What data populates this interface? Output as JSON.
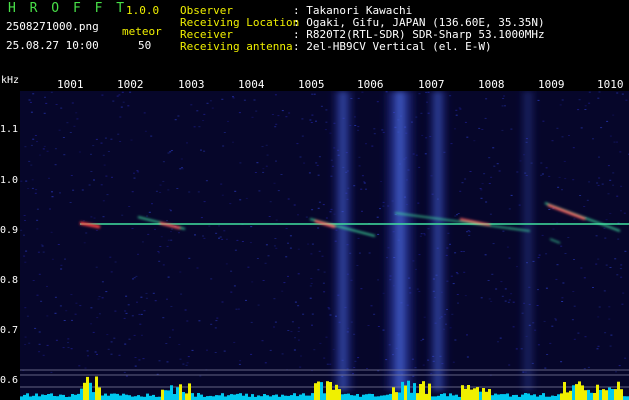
{
  "app": {
    "name": "H R O F F T",
    "version": "1.0.0",
    "filename": "2508271000.png",
    "mode": "meteor",
    "datetime": "25.08.27 10:00",
    "count": "50"
  },
  "info": {
    "observer_label": "Observer",
    "observer_value": ": Takanori Kawachi",
    "location_label": "Receiving Location",
    "location_value": ": Ogaki, Gifu, JAPAN (136.60E, 35.35N)",
    "receiver_label": "Receiver",
    "receiver_value": ": R820T2(RTL-SDR) SDR-Sharp 53.1000MHz",
    "antenna_label": "Receiving antenna",
    "antenna_value": ": 2el-HB9CV Vertical (el. E-W)"
  },
  "axes": {
    "y_unit": "kHz",
    "x_ticks": [
      "1001",
      "1002",
      "1003",
      "1004",
      "1005",
      "1006",
      "1007",
      "1008",
      "1009",
      "1010"
    ],
    "y_ticks": [
      "1.1",
      "1.0",
      "0.9",
      "0.8",
      "0.7",
      "0.6"
    ]
  },
  "colors": {
    "background": "#000000",
    "header_green": "#48e048",
    "header_yellow": "#f0f000",
    "header_white": "#ffffff",
    "noise_blue": "#1a1a8a",
    "signal_line": "#40e0a0",
    "baseline_fill": "#00c8f0",
    "baseline_peak": "#f0f000"
  }
}
